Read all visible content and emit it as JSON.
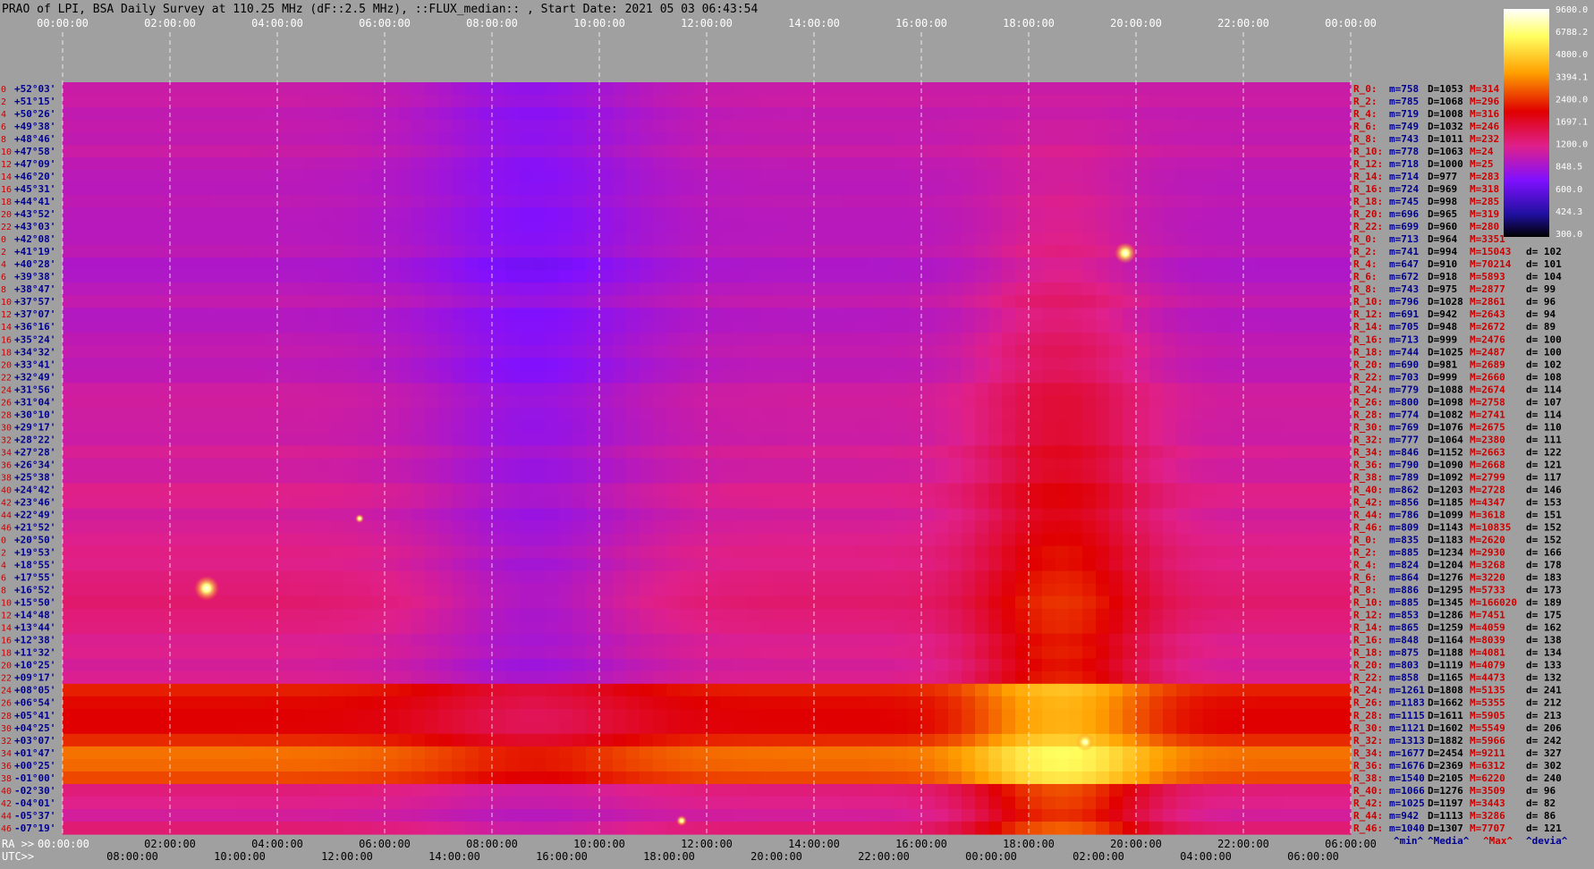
{
  "chart_data": {
    "type": "heatmap",
    "title": "PRAO of LPI, BSA Daily Survey at 110.25 MHz (dF::2.5 MHz), ::FLUX_median:: , Start Date: 2021 05 03 06:43:54",
    "top_axis_ticks": [
      "00:00:00",
      "02:00:00",
      "04:00:00",
      "06:00:00",
      "08:00:00",
      "10:00:00",
      "12:00:00",
      "14:00:00",
      "16:00:00",
      "18:00:00",
      "20:00:00",
      "22:00:00",
      "00:00:00"
    ],
    "ra_axis_label": "RA >>",
    "ra_axis_ticks": [
      "00:00:00",
      "02:00:00",
      "04:00:00",
      "06:00:00",
      "08:00:00",
      "10:00:00",
      "12:00:00",
      "14:00:00",
      "16:00:00",
      "18:00:00",
      "20:00:00",
      "22:00:00",
      "06:00:00"
    ],
    "utc_axis_label": "UTC>>",
    "utc_axis_ticks": [
      "08:00:00",
      "10:00:00",
      "12:00:00",
      "14:00:00",
      "16:00:00",
      "18:00:00",
      "20:00:00",
      "22:00:00",
      "00:00:00",
      "02:00:00",
      "04:00:00",
      "06:00:00"
    ],
    "colorbar_ticks": [
      "9600.0",
      "6788.2",
      "4800.0",
      "3394.1",
      "2400.0",
      "1697.1",
      "1200.0",
      "848.5",
      "600.0",
      "424.3",
      "300.0"
    ],
    "colorbar_range": [
      300,
      9600
    ],
    "colorbar_scale": "log",
    "beam_index_labels": [
      "0",
      "2",
      "4",
      "6",
      "8",
      "10",
      "12",
      "14",
      "16",
      "18",
      "20",
      "22",
      "0",
      "2",
      "4",
      "6",
      "8",
      "10",
      "12",
      "14",
      "16",
      "18",
      "20",
      "22",
      "24",
      "26",
      "28",
      "30",
      "32",
      "34",
      "36",
      "38",
      "40",
      "42",
      "44",
      "46",
      "0",
      "2",
      "4",
      "6",
      "8",
      "10",
      "12",
      "14",
      "16",
      "18",
      "20",
      "22",
      "24",
      "26",
      "28",
      "30",
      "32",
      "34",
      "36",
      "38",
      "40",
      "42",
      "44",
      "46"
    ],
    "declinations": [
      "+52°03'",
      "+51°15'",
      "+50°26'",
      "+49°38'",
      "+48°46'",
      "+47°58'",
      "+47°09'",
      "+46°20'",
      "+45°31'",
      "+44°41'",
      "+43°52'",
      "+43°03'",
      "+42°08'",
      "+41°19'",
      "+40°28'",
      "+39°38'",
      "+38°47'",
      "+37°57'",
      "+37°07'",
      "+36°16'",
      "+35°24'",
      "+34°32'",
      "+33°41'",
      "+32°49'",
      "+31°56'",
      "+31°04'",
      "+30°10'",
      "+29°17'",
      "+28°22'",
      "+27°28'",
      "+26°34'",
      "+25°38'",
      "+24°42'",
      "+23°46'",
      "+22°49'",
      "+21°52'",
      "+20°50'",
      "+19°53'",
      "+18°55'",
      "+17°55'",
      "+16°52'",
      "+15°50'",
      "+14°48'",
      "+13°44'",
      "+12°38'",
      "+11°32'",
      "+10°25'",
      "+09°17'",
      "+08°05'",
      "+06°54'",
      "+05°41'",
      "+04°25'",
      "+03°07'",
      "+01°47'",
      "+00°25'",
      "-01°00'",
      "-02°30'",
      "-04°01'",
      "-05°37'",
      "-07°19'"
    ],
    "stats_rows": [
      {
        "r": "R_0:",
        "m": "m=758",
        "D": "D=1053",
        "M": "M=314",
        "d": ""
      },
      {
        "r": "R_2:",
        "m": "m=785",
        "D": "D=1068",
        "M": "M=296",
        "d": ""
      },
      {
        "r": "R_4:",
        "m": "m=719",
        "D": "D=1008",
        "M": "M=316",
        "d": ""
      },
      {
        "r": "R_6:",
        "m": "m=749",
        "D": "D=1032",
        "M": "M=246",
        "d": ""
      },
      {
        "r": "R_8:",
        "m": "m=743",
        "D": "D=1011",
        "M": "M=232",
        "d": ""
      },
      {
        "r": "R_10:",
        "m": "m=778",
        "D": "D=1063",
        "M": "M=24",
        "d": ""
      },
      {
        "r": "R_12:",
        "m": "m=718",
        "D": "D=1000",
        "M": "M=25",
        "d": ""
      },
      {
        "r": "R_14:",
        "m": "m=714",
        "D": "D=977",
        "M": "M=283",
        "d": ""
      },
      {
        "r": "R_16:",
        "m": "m=724",
        "D": "D=969",
        "M": "M=318",
        "d": ""
      },
      {
        "r": "R_18:",
        "m": "m=745",
        "D": "D=998",
        "M": "M=285",
        "d": ""
      },
      {
        "r": "R_20:",
        "m": "m=696",
        "D": "D=965",
        "M": "M=319",
        "d": ""
      },
      {
        "r": "R_22:",
        "m": "m=699",
        "D": "D=960",
        "M": "M=280",
        "d": ""
      },
      {
        "r": "R_0:",
        "m": "m=713",
        "D": "D=964",
        "M": "M=3351",
        "d": ""
      },
      {
        "r": "R_2:",
        "m": "m=741",
        "D": "D=994",
        "M": "M=15043",
        "d": "d= 102"
      },
      {
        "r": "R_4:",
        "m": "m=647",
        "D": "D=910",
        "M": "M=70214",
        "d": "d= 101"
      },
      {
        "r": "R_6:",
        "m": "m=672",
        "D": "D=918",
        "M": "M=5893",
        "d": "d= 104"
      },
      {
        "r": "R_8:",
        "m": "m=743",
        "D": "D=975",
        "M": "M=2877",
        "d": "d= 99"
      },
      {
        "r": "R_10:",
        "m": "m=796",
        "D": "D=1028",
        "M": "M=2861",
        "d": "d= 96"
      },
      {
        "r": "R_12:",
        "m": "m=691",
        "D": "D=942",
        "M": "M=2643",
        "d": "d= 94"
      },
      {
        "r": "R_14:",
        "m": "m=705",
        "D": "D=948",
        "M": "M=2672",
        "d": "d= 89"
      },
      {
        "r": "R_16:",
        "m": "m=713",
        "D": "D=999",
        "M": "M=2476",
        "d": "d= 100"
      },
      {
        "r": "R_18:",
        "m": "m=744",
        "D": "D=1025",
        "M": "M=2487",
        "d": "d= 100"
      },
      {
        "r": "R_20:",
        "m": "m=690",
        "D": "D=981",
        "M": "M=2689",
        "d": "d= 102"
      },
      {
        "r": "R_22:",
        "m": "m=703",
        "D": "D=999",
        "M": "M=2660",
        "d": "d= 108"
      },
      {
        "r": "R_24:",
        "m": "m=779",
        "D": "D=1088",
        "M": "M=2674",
        "d": "d= 114"
      },
      {
        "r": "R_26:",
        "m": "m=800",
        "D": "D=1098",
        "M": "M=2758",
        "d": "d= 107"
      },
      {
        "r": "R_28:",
        "m": "m=774",
        "D": "D=1082",
        "M": "M=2741",
        "d": "d= 114"
      },
      {
        "r": "R_30:",
        "m": "m=769",
        "D": "D=1076",
        "M": "M=2675",
        "d": "d= 110"
      },
      {
        "r": "R_32:",
        "m": "m=777",
        "D": "D=1064",
        "M": "M=2380",
        "d": "d= 111"
      },
      {
        "r": "R_34:",
        "m": "m=846",
        "D": "D=1152",
        "M": "M=2663",
        "d": "d= 122"
      },
      {
        "r": "R_36:",
        "m": "m=790",
        "D": "D=1090",
        "M": "M=2668",
        "d": "d= 121"
      },
      {
        "r": "R_38:",
        "m": "m=789",
        "D": "D=1092",
        "M": "M=2799",
        "d": "d= 117"
      },
      {
        "r": "R_40:",
        "m": "m=862",
        "D": "D=1203",
        "M": "M=2728",
        "d": "d= 146"
      },
      {
        "r": "R_42:",
        "m": "m=856",
        "D": "D=1185",
        "M": "M=4347",
        "d": "d= 153"
      },
      {
        "r": "R_44:",
        "m": "m=786",
        "D": "D=1099",
        "M": "M=3618",
        "d": "d= 151"
      },
      {
        "r": "R_46:",
        "m": "m=809",
        "D": "D=1143",
        "M": "M=10835",
        "d": "d= 152"
      },
      {
        "r": "R_0:",
        "m": "m=835",
        "D": "D=1183",
        "M": "M=2620",
        "d": "d= 152"
      },
      {
        "r": "R_2:",
        "m": "m=885",
        "D": "D=1234",
        "M": "M=2930",
        "d": "d= 166"
      },
      {
        "r": "R_4:",
        "m": "m=824",
        "D": "D=1204",
        "M": "M=3268",
        "d": "d= 178"
      },
      {
        "r": "R_6:",
        "m": "m=864",
        "D": "D=1276",
        "M": "M=3220",
        "d": "d= 183"
      },
      {
        "r": "R_8:",
        "m": "m=886",
        "D": "D=1295",
        "M": "M=5733",
        "d": "d= 173"
      },
      {
        "r": "R_10:",
        "m": "m=885",
        "D": "D=1345",
        "M": "M=166020",
        "d": "d= 189"
      },
      {
        "r": "R_12:",
        "m": "m=853",
        "D": "D=1286",
        "M": "M=7451",
        "d": "d= 175"
      },
      {
        "r": "R_14:",
        "m": "m=865",
        "D": "D=1259",
        "M": "M=4059",
        "d": "d= 162"
      },
      {
        "r": "R_16:",
        "m": "m=848",
        "D": "D=1164",
        "M": "M=8039",
        "d": "d= 138"
      },
      {
        "r": "R_18:",
        "m": "m=875",
        "D": "D=1188",
        "M": "M=4081",
        "d": "d= 134"
      },
      {
        "r": "R_20:",
        "m": "m=803",
        "D": "D=1119",
        "M": "M=4079",
        "d": "d= 133"
      },
      {
        "r": "R_22:",
        "m": "m=858",
        "D": "D=1165",
        "M": "M=4473",
        "d": "d= 132"
      },
      {
        "r": "R_24:",
        "m": "m=1261",
        "D": "D=1808",
        "M": "M=5135",
        "d": "d= 241"
      },
      {
        "r": "R_26:",
        "m": "m=1183",
        "D": "D=1662",
        "M": "M=5355",
        "d": "d= 212"
      },
      {
        "r": "R_28:",
        "m": "m=1115",
        "D": "D=1611",
        "M": "M=5905",
        "d": "d= 213"
      },
      {
        "r": "R_30:",
        "m": "m=1121",
        "D": "D=1602",
        "M": "M=5549",
        "d": "d= 206"
      },
      {
        "r": "R_32:",
        "m": "m=1313",
        "D": "D=1882",
        "M": "M=5966",
        "d": "d= 242"
      },
      {
        "r": "R_34:",
        "m": "m=1677",
        "D": "D=2454",
        "M": "M=9211",
        "d": "d= 327"
      },
      {
        "r": "R_36:",
        "m": "m=1676",
        "D": "D=2369",
        "M": "M=6312",
        "d": "d= 302"
      },
      {
        "r": "R_38:",
        "m": "m=1540",
        "D": "D=2105",
        "M": "M=6220",
        "d": "d= 240"
      },
      {
        "r": "R_40:",
        "m": "m=1066",
        "D": "D=1276",
        "M": "M=3509",
        "d": "d= 96"
      },
      {
        "r": "R_42:",
        "m": "m=1025",
        "D": "D=1197",
        "M": "M=3443",
        "d": "d= 82"
      },
      {
        "r": "R_44:",
        "m": "m=942",
        "D": "D=1113",
        "M": "M=3286",
        "d": "d= 86"
      },
      {
        "r": "R_46:",
        "m": "m=1040",
        "D": "D=1307",
        "M": "M=7707",
        "d": "d= 121"
      }
    ],
    "stats_footer": [
      "^min^",
      "^Media^",
      "^Max^",
      "^devia^"
    ],
    "colors": {
      "blue": "#000090",
      "red": "#cc0000",
      "bg": "#a0a0a0"
    }
  }
}
